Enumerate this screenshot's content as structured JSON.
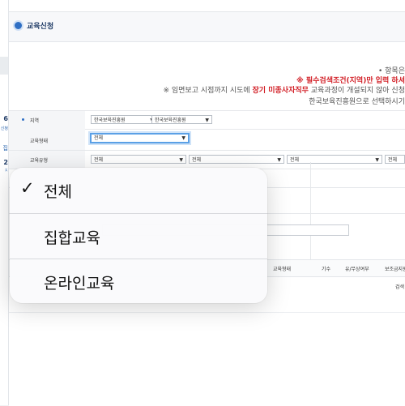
{
  "sidebar": {
    "numbers": [
      "6",
      "2"
    ],
    "sub_labels": [
      "신청",
      "집",
      "ㅈ"
    ]
  },
  "header": {
    "title": "교육신청"
  },
  "notes": {
    "line1": "• 항목은",
    "line2": "※ 필수검색조건(지역)만 입력 하셔",
    "line3_prefix": "※ 임면보고 시점까지 시도에 ",
    "line3_highlight": "장기 미종사자직무",
    "line3_suffix": " 교육과정이 개설되지 않아 신청",
    "line4": "한국보육진흥원으로 선택하시기"
  },
  "form": {
    "region": {
      "label": "지역",
      "select1": "한국보육진흥원",
      "select2": "한국보육진흥원"
    },
    "edu_form": {
      "label": "교육형태",
      "value": "전체"
    },
    "edu_type": {
      "label": "교육유형",
      "select1": "전체",
      "select2": "전체",
      "select3": "전체",
      "select4": "전체"
    }
  },
  "table": {
    "headers": [
      "교육형태",
      "기수",
      "유/무상여부",
      "보조금지원"
    ],
    "search_label": "검색"
  },
  "dropdown": {
    "selected_index": 0,
    "options": [
      "전체",
      "집합교육",
      "온라인교육"
    ]
  },
  "icons": {
    "check": "check-icon",
    "arrow": "chevron-down-icon",
    "title": "circle-bullet-icon"
  },
  "colors": {
    "accent": "#2f6fc4",
    "warning": "#d21f26",
    "focus": "#5aa0e6"
  }
}
